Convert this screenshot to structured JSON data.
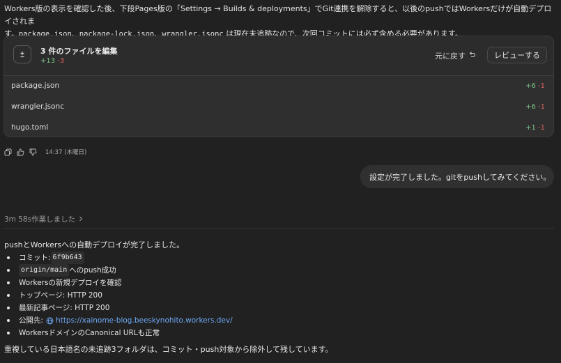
{
  "top_message": {
    "line1": "Workers版の表示を確認した後、下段Pages版の「Settings → Builds & deployments」でGit連携を解除すると、以後のpushではWorkersだけが自動デプロイされま",
    "line2_prefix": "す。",
    "code1": "package.json",
    "sep1": "、",
    "code2": "package-lock.json",
    "sep2": "、",
    "code3": "wrangler.jsonc",
    "line2_suffix": " は現在未追跡なので、次回コミットには必ず含める必要があります。"
  },
  "edit_card": {
    "title": "3 件のファイルを編集",
    "added": "+13",
    "removed": "-3",
    "undo_label": "元に戻す",
    "undo_icon": "undo-arrow-icon",
    "review_label": "レビューする",
    "files": [
      {
        "name": "package.json",
        "added": "+6",
        "removed": "-1"
      },
      {
        "name": "wrangler.jsonc",
        "added": "+6",
        "removed": "-1"
      },
      {
        "name": "hugo.toml",
        "added": "+1",
        "removed": "-1"
      }
    ]
  },
  "message_actions": {
    "timestamp": "14:37 (木曜日)"
  },
  "user_message": {
    "text": "設定が完了しました。gitをpushしてみてください。"
  },
  "worked": {
    "label": "3m 58s作業しました"
  },
  "answer": {
    "intro": "pushとWorkersへの自動デプロイが完了しました。",
    "bullets": {
      "b1_prefix": "コミット: ",
      "b1_code": "6f9b643",
      "b2_code": "origin/main",
      "b2_suffix": " へのpush成功",
      "b3": "Workersの新規デプロイを確認",
      "b4": "トップページ: HTTP 200",
      "b5": "最新記事ページ: HTTP 200",
      "b6_prefix": "公開先:",
      "b6_link": "https://xainome-blog.beeskynohito.workers.dev/",
      "b7": "WorkersドメインのCanonical URLも正常"
    },
    "footer": "重複している日本語名の未追跡3フォルダは、コミット・push対象から除外して残しています。"
  },
  "colors": {
    "background": "#212121",
    "card": "#2f2f2f",
    "added": "#7fc48b",
    "removed": "#e06262",
    "link": "#6ea8f4"
  }
}
